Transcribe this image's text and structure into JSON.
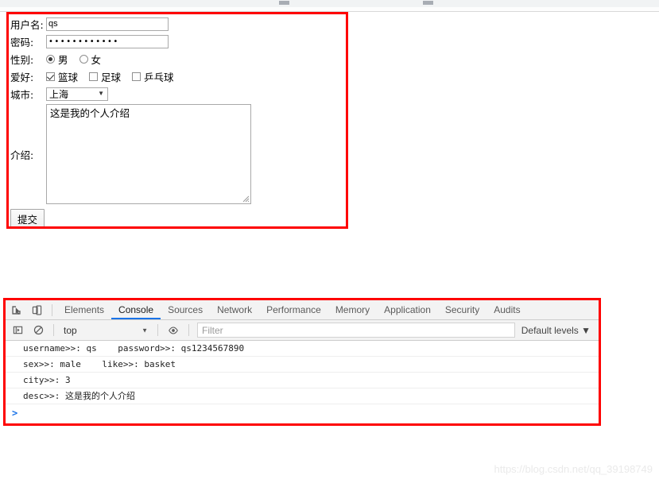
{
  "browser_chrome": {
    "present": true
  },
  "form": {
    "fields": [
      {
        "label": "用户名:",
        "type": "text",
        "value": "qs",
        "name": "username"
      },
      {
        "label": "密码:",
        "type": "password",
        "value": "••••••••••••",
        "name": "password"
      },
      {
        "label": "性别:",
        "type": "radio",
        "name": "sex"
      },
      {
        "label": "爱好:",
        "type": "checkbox",
        "name": "like"
      },
      {
        "label": "城市:",
        "type": "select",
        "name": "city"
      }
    ],
    "username_label": "用户名:",
    "username_value": "qs",
    "password_label": "密码:",
    "password_value": "••••••••••••",
    "sex_label": "性别:",
    "sex_options": [
      {
        "text": "男",
        "checked": true
      },
      {
        "text": "女",
        "checked": false
      }
    ],
    "like_label": "爱好:",
    "like_options": [
      {
        "text": "篮球",
        "checked": true
      },
      {
        "text": "足球",
        "checked": false
      },
      {
        "text": "乒乓球",
        "checked": false
      }
    ],
    "city_label": "城市:",
    "city_selected": "上海",
    "desc_label": "介绍:",
    "desc_value": "这是我的个人介绍",
    "submit_label": "提交"
  },
  "devtools": {
    "toolbar_icons": [
      {
        "name": "inspect-element-icon"
      },
      {
        "name": "device-toolbar-icon"
      }
    ],
    "tabs": [
      {
        "label": "Elements",
        "active": false
      },
      {
        "label": "Console",
        "active": true
      },
      {
        "label": "Sources",
        "active": false
      },
      {
        "label": "Network",
        "active": false
      },
      {
        "label": "Performance",
        "active": false
      },
      {
        "label": "Memory",
        "active": false
      },
      {
        "label": "Application",
        "active": false
      },
      {
        "label": "Security",
        "active": false
      },
      {
        "label": "Audits",
        "active": false
      }
    ],
    "filterbar": {
      "sidebar_toggle_icon": "console-sidebar-icon",
      "clear_icon": "clear-console-icon",
      "context": "top",
      "eye_icon": "live-expression-eye-icon",
      "filter_placeholder": "Filter",
      "filter_value": "",
      "levels": "Default levels ▼"
    },
    "console_lines": [
      "username>>: qs    password>>: qs1234567890",
      "sex>>: male    like>>: basket",
      "city>>: 3",
      "desc>>: 这是我的个人介绍"
    ],
    "prompt": ">"
  },
  "watermark": "https://blog.csdn.net/qq_39198749",
  "colors": {
    "annotation_red": "#fe0000",
    "tab_active_blue": "#1a73e8",
    "prompt_blue": "#1a73e8"
  }
}
